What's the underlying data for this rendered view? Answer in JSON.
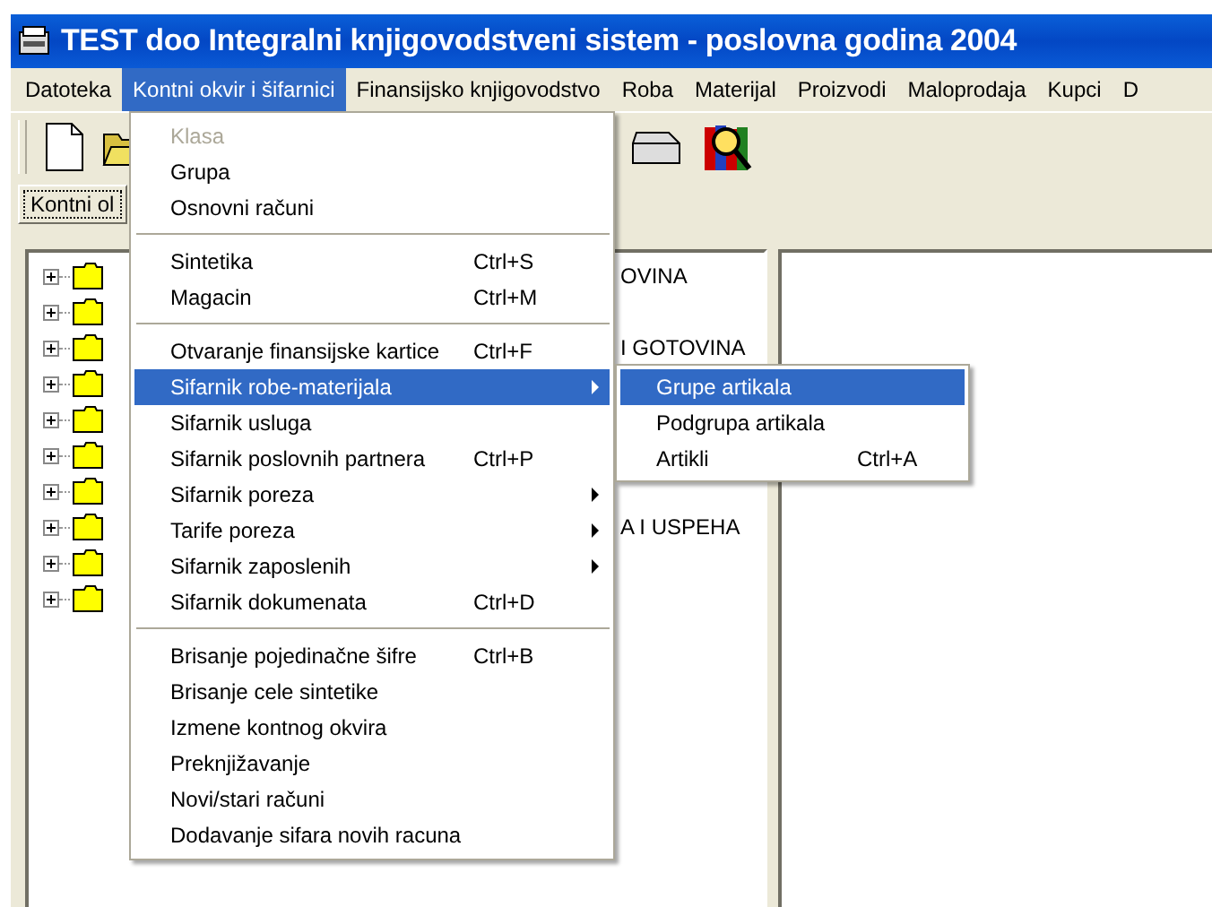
{
  "window": {
    "title": "TEST doo Integralni knjigovodstveni sistem - poslovna godina 2004"
  },
  "menubar": [
    {
      "label": "Datoteka",
      "selected": false
    },
    {
      "label": "Kontni okvir i šifarnici",
      "selected": true
    },
    {
      "label": "Finansijsko knjigovodstvo",
      "selected": false
    },
    {
      "label": "Roba",
      "selected": false
    },
    {
      "label": "Materijal",
      "selected": false
    },
    {
      "label": "Proizvodi",
      "selected": false
    },
    {
      "label": "Maloprodaja",
      "selected": false
    },
    {
      "label": "Kupci",
      "selected": false
    },
    {
      "label": "D",
      "selected": false
    }
  ],
  "tab": {
    "label": "Kontni ol"
  },
  "tree": [
    {
      "label": "OVINA",
      "expanded": false
    },
    {
      "expanded": false
    },
    {
      "label": "I GOTOVINA",
      "expanded": false
    },
    {
      "expanded": false
    },
    {
      "expanded": false
    },
    {
      "expanded": false
    },
    {
      "expanded": false
    },
    {
      "label": "A I USPEHA",
      "expanded": false
    },
    {
      "expanded": false
    },
    {
      "expanded": false
    }
  ],
  "menu": [
    {
      "kind": "item",
      "label": "Klasa",
      "disabled": true,
      "selected": false
    },
    {
      "kind": "item",
      "label": "Grupa",
      "disabled": false,
      "selected": false
    },
    {
      "kind": "item",
      "label": "Osnovni računi",
      "disabled": false,
      "selected": false
    },
    {
      "kind": "separator"
    },
    {
      "kind": "item",
      "label": "Sintetika",
      "shortcut": "Ctrl+S",
      "disabled": false,
      "selected": false
    },
    {
      "kind": "item",
      "label": "Magacin",
      "shortcut": "Ctrl+M",
      "disabled": false,
      "selected": false
    },
    {
      "kind": "separator"
    },
    {
      "kind": "item",
      "label": "Otvaranje finansijske kartice",
      "shortcut": "Ctrl+F",
      "disabled": false,
      "selected": false
    },
    {
      "kind": "item",
      "label": "Sifarnik robe-materijala",
      "submenu": true,
      "disabled": false,
      "selected": true
    },
    {
      "kind": "item",
      "label": "Sifarnik usluga",
      "disabled": false,
      "selected": false
    },
    {
      "kind": "item",
      "label": "Sifarnik poslovnih partnera",
      "shortcut": "Ctrl+P",
      "disabled": false,
      "selected": false
    },
    {
      "kind": "item",
      "label": "Sifarnik poreza",
      "submenu": true,
      "disabled": false,
      "selected": false
    },
    {
      "kind": "item",
      "label": "Tarife poreza",
      "submenu": true,
      "disabled": false,
      "selected": false
    },
    {
      "kind": "item",
      "label": "Sifarnik zaposlenih",
      "submenu": true,
      "disabled": false,
      "selected": false
    },
    {
      "kind": "item",
      "label": "Sifarnik dokumenata",
      "shortcut": "Ctrl+D",
      "disabled": false,
      "selected": false
    },
    {
      "kind": "separator"
    },
    {
      "kind": "item",
      "label": "Brisanje pojedinačne šifre",
      "shortcut": "Ctrl+B",
      "disabled": false,
      "selected": false
    },
    {
      "kind": "item",
      "label": "Brisanje cele sintetike",
      "disabled": false,
      "selected": false
    },
    {
      "kind": "item",
      "label": "Izmene kontnog okvira",
      "disabled": false,
      "selected": false
    },
    {
      "kind": "item",
      "label": "Preknjižavanje",
      "disabled": false,
      "selected": false
    },
    {
      "kind": "item",
      "label": "Novi/stari računi",
      "disabled": false,
      "selected": false
    },
    {
      "kind": "item",
      "label": "Dodavanje sifara novih racuna",
      "disabled": false,
      "selected": false
    }
  ],
  "submenu": [
    {
      "label": "Grupe artikala",
      "selected": true
    },
    {
      "label": "Podgrupa artikala",
      "selected": false
    },
    {
      "label": "Artikli",
      "shortcut": "Ctrl+A",
      "selected": false
    }
  ]
}
